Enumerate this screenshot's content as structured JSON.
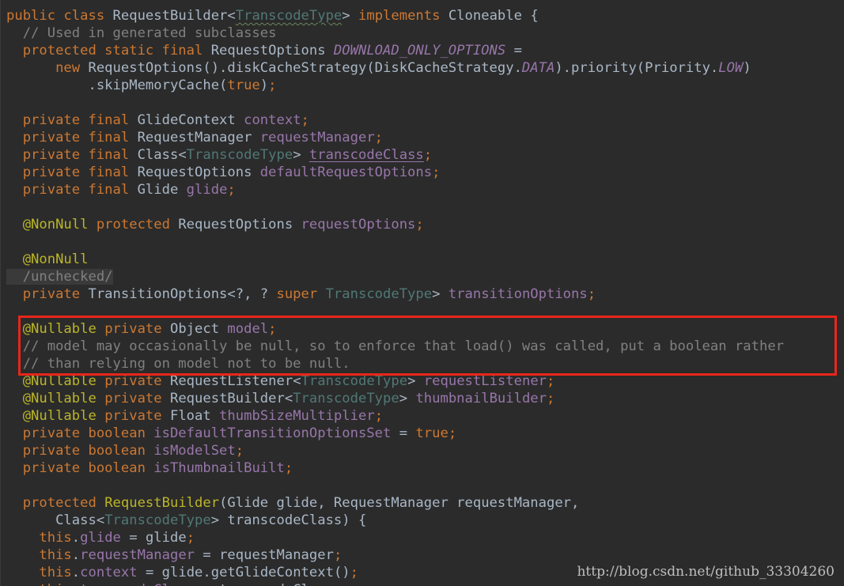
{
  "editor": {
    "lines": [
      [
        [
          "kw",
          "public "
        ],
        [
          "kw",
          "class "
        ],
        [
          "cls",
          "RequestBuilder"
        ],
        [
          "plain",
          "<"
        ],
        [
          "tp",
          "TranscodeType"
        ],
        [
          "plain",
          "> "
        ],
        [
          "kw",
          "implements "
        ],
        [
          "cls",
          "Cloneable "
        ],
        [
          "plain",
          "{"
        ]
      ],
      [
        [
          "cmt",
          "  // Used in generated subclasses"
        ]
      ],
      [
        [
          "kw",
          "  protected static final "
        ],
        [
          "cls",
          "RequestOptions "
        ],
        [
          "sfld",
          "DOWNLOAD_ONLY_OPTIONS "
        ],
        [
          "plain",
          "="
        ]
      ],
      [
        [
          "kw",
          "      new "
        ],
        [
          "cls",
          "RequestOptions"
        ],
        [
          "plain",
          "().diskCacheStrategy(DiskCacheStrategy."
        ],
        [
          "sfld",
          "DATA"
        ],
        [
          "plain",
          ").priority(Priority."
        ],
        [
          "sfld",
          "LOW"
        ],
        [
          "plain",
          ")"
        ]
      ],
      [
        [
          "plain",
          "          .skipMemoryCache("
        ],
        [
          "kw",
          "true"
        ],
        [
          "plain",
          ")"
        ],
        [
          "pun",
          ";"
        ]
      ],
      [],
      [
        [
          "kw",
          "  private final "
        ],
        [
          "cls",
          "GlideContext "
        ],
        [
          "fld",
          "context"
        ],
        [
          "pun",
          ";"
        ]
      ],
      [
        [
          "kw",
          "  private final "
        ],
        [
          "cls",
          "RequestManager "
        ],
        [
          "fld",
          "requestManager"
        ],
        [
          "pun",
          ";"
        ]
      ],
      [
        [
          "kw",
          "  private final "
        ],
        [
          "cls",
          "Class<"
        ],
        [
          "tp",
          "TranscodeType"
        ],
        [
          "cls",
          "> "
        ],
        [
          "fld",
          "transcodeClass"
        ],
        [
          "pun",
          ";"
        ]
      ],
      [
        [
          "kw",
          "  private final "
        ],
        [
          "cls",
          "RequestOptions "
        ],
        [
          "fld",
          "defaultRequestOptions"
        ],
        [
          "pun",
          ";"
        ]
      ],
      [
        [
          "kw",
          "  private final "
        ],
        [
          "cls",
          "Glide "
        ],
        [
          "fld",
          "glide"
        ],
        [
          "pun",
          ";"
        ]
      ],
      [],
      [
        [
          "ann",
          "  @NonNull "
        ],
        [
          "kw",
          "protected "
        ],
        [
          "cls",
          "RequestOptions "
        ],
        [
          "fld",
          "requestOptions"
        ],
        [
          "pun",
          ";"
        ]
      ],
      [],
      [
        [
          "ann",
          "  @NonNull"
        ]
      ],
      [
        [
          "cmt",
          "  /unchecked/"
        ]
      ],
      [
        [
          "kw",
          "  private "
        ],
        [
          "cls",
          "TransitionOptions<?, ? "
        ],
        [
          "kw",
          "super "
        ],
        [
          "tp",
          "TranscodeType"
        ],
        [
          "cls",
          "> "
        ],
        [
          "fld",
          "transitionOptions"
        ],
        [
          "pun",
          ";"
        ]
      ],
      [],
      [
        [
          "ann",
          "  @Nullable "
        ],
        [
          "kw",
          "private "
        ],
        [
          "cls",
          "Object "
        ],
        [
          "fld",
          "model"
        ],
        [
          "pun",
          ";"
        ]
      ],
      [
        [
          "cmt",
          "  // model may occasionally be null, so to enforce that load() was called, put a boolean rather"
        ]
      ],
      [
        [
          "cmt",
          "  // than relying on model not to be null."
        ]
      ],
      [
        [
          "ann",
          "  @Nullable "
        ],
        [
          "kw",
          "private "
        ],
        [
          "cls",
          "RequestListener<"
        ],
        [
          "tp",
          "TranscodeType"
        ],
        [
          "cls",
          "> "
        ],
        [
          "fld",
          "requestListener"
        ],
        [
          "pun",
          ";"
        ]
      ],
      [
        [
          "ann",
          "  @Nullable "
        ],
        [
          "kw",
          "private "
        ],
        [
          "cls",
          "RequestBuilder<"
        ],
        [
          "tp",
          "TranscodeType"
        ],
        [
          "cls",
          "> "
        ],
        [
          "fld",
          "thumbnailBuilder"
        ],
        [
          "pun",
          ";"
        ]
      ],
      [
        [
          "ann",
          "  @Nullable "
        ],
        [
          "kw",
          "private "
        ],
        [
          "cls",
          "Float "
        ],
        [
          "fld",
          "thumbSizeMultiplier"
        ],
        [
          "pun",
          ";"
        ]
      ],
      [
        [
          "kw",
          "  private boolean "
        ],
        [
          "fld",
          "isDefaultTransitionOptionsSet "
        ],
        [
          "plain",
          "= "
        ],
        [
          "kw",
          "true"
        ],
        [
          "pun",
          ";"
        ]
      ],
      [
        [
          "kw",
          "  private boolean "
        ],
        [
          "fld",
          "isModelSet"
        ],
        [
          "pun",
          ";"
        ]
      ],
      [
        [
          "kw",
          "  private boolean "
        ],
        [
          "fld",
          "isThumbnailBuilt"
        ],
        [
          "pun",
          ";"
        ]
      ],
      [],
      [
        [
          "kw",
          "  protected "
        ],
        [
          "ann",
          "RequestBuilder"
        ],
        [
          "plain",
          "(Glide glide, RequestManager requestManager,"
        ]
      ],
      [
        [
          "plain",
          "      Class<"
        ],
        [
          "tp",
          "TranscodeType"
        ],
        [
          "plain",
          "> transcodeClass) {"
        ]
      ],
      [
        [
          "kw",
          "    this"
        ],
        [
          "plain",
          "."
        ],
        [
          "fld",
          "glide "
        ],
        [
          "plain",
          "= glide"
        ],
        [
          "pun",
          ";"
        ]
      ],
      [
        [
          "kw",
          "    this"
        ],
        [
          "plain",
          "."
        ],
        [
          "fld",
          "requestManager "
        ],
        [
          "plain",
          "= requestManager"
        ],
        [
          "pun",
          ";"
        ]
      ],
      [
        [
          "kw",
          "    this"
        ],
        [
          "plain",
          "."
        ],
        [
          "fld",
          "context "
        ],
        [
          "plain",
          "= glide.getGlideContext()"
        ],
        [
          "pun",
          ";"
        ]
      ],
      [
        [
          "kw",
          "    this"
        ],
        [
          "plain",
          "."
        ],
        [
          "fld",
          "transcodeClass "
        ],
        [
          "plain",
          "= transcodeClass"
        ],
        [
          "pun",
          ";"
        ]
      ]
    ]
  },
  "watermark": "http://blog.csdn.net/github_33304260",
  "colors": {
    "background": "#2b2b2b",
    "keyword": "#cc7832",
    "field": "#9876aa",
    "comment": "#808080",
    "annotation": "#bbb529",
    "type_param": "#507874",
    "text": "#a9b7c6",
    "highlight_border": "#e8261a"
  }
}
